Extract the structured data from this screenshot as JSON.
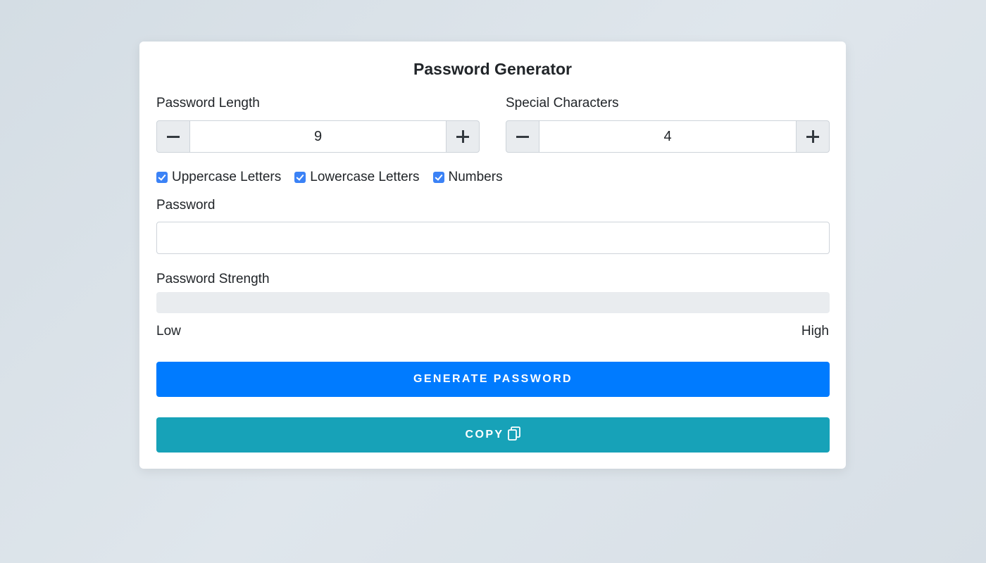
{
  "title": "Password Generator",
  "length": {
    "label": "Password Length",
    "value": "9",
    "minus": "−",
    "plus": "+"
  },
  "special": {
    "label": "Special Characters",
    "value": "4",
    "minus": "−",
    "plus": "+"
  },
  "options": [
    {
      "label": "Uppercase Letters",
      "checked": true
    },
    {
      "label": "Lowercase Letters",
      "checked": true
    },
    {
      "label": "Numbers",
      "checked": true
    }
  ],
  "password": {
    "label": "Password",
    "value": ""
  },
  "strength": {
    "label": "Password Strength",
    "level": 0,
    "low_label": "Low",
    "high_label": "High"
  },
  "buttons": {
    "generate_label": "GENERATE PASSWORD",
    "copy_label": "COPY",
    "copy_icon": "copy-icon"
  },
  "colors": {
    "primary": "#007bff",
    "info": "#17a2b8",
    "checkbox": "#3b82f6"
  }
}
